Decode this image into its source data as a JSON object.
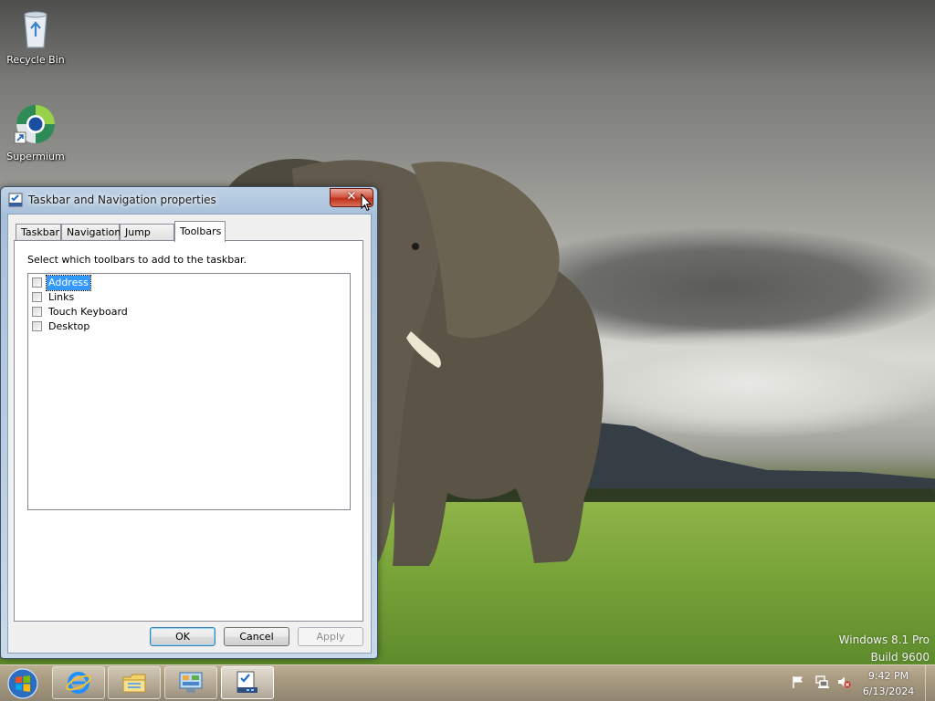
{
  "desktop": {
    "icons": [
      {
        "label": "Recycle Bin",
        "icon": "recycle-bin-icon"
      },
      {
        "label": "Supermium",
        "icon": "supermium-browser-icon"
      }
    ],
    "watermark": {
      "line1": "Windows 8.1 Pro",
      "line2": "Build 9600"
    }
  },
  "dialog": {
    "title": "Taskbar and Navigation properties",
    "close_label": "✕",
    "tabs": [
      {
        "label": "Taskbar",
        "active": false
      },
      {
        "label": "Navigation",
        "active": false
      },
      {
        "label": "Jump Lists",
        "active": false
      },
      {
        "label": "Toolbars",
        "active": true
      }
    ],
    "instruction": "Select which toolbars to add to the taskbar.",
    "toolbars": [
      {
        "label": "Address",
        "checked": false,
        "selected": true
      },
      {
        "label": "Links",
        "checked": false,
        "selected": false
      },
      {
        "label": "Touch Keyboard",
        "checked": false,
        "selected": false
      },
      {
        "label": "Desktop",
        "checked": false,
        "selected": false
      }
    ],
    "buttons": {
      "ok": "OK",
      "cancel": "Cancel",
      "apply": "Apply"
    }
  },
  "taskbar": {
    "start_icon": "windows-start-icon",
    "pinned": [
      {
        "icon": "internet-explorer-icon",
        "active": false
      },
      {
        "icon": "file-explorer-icon",
        "active": false
      },
      {
        "icon": "control-panel-icon",
        "active": false
      },
      {
        "icon": "taskbar-properties-icon",
        "active": true
      }
    ],
    "tray_icons": [
      "action-center-flag-icon",
      "network-icon",
      "volume-muted-icon"
    ],
    "clock": {
      "time": "9:42 PM",
      "date": "6/13/2024"
    }
  },
  "colors": {
    "selection": "#3399ff",
    "close_button": "#c0311a"
  }
}
